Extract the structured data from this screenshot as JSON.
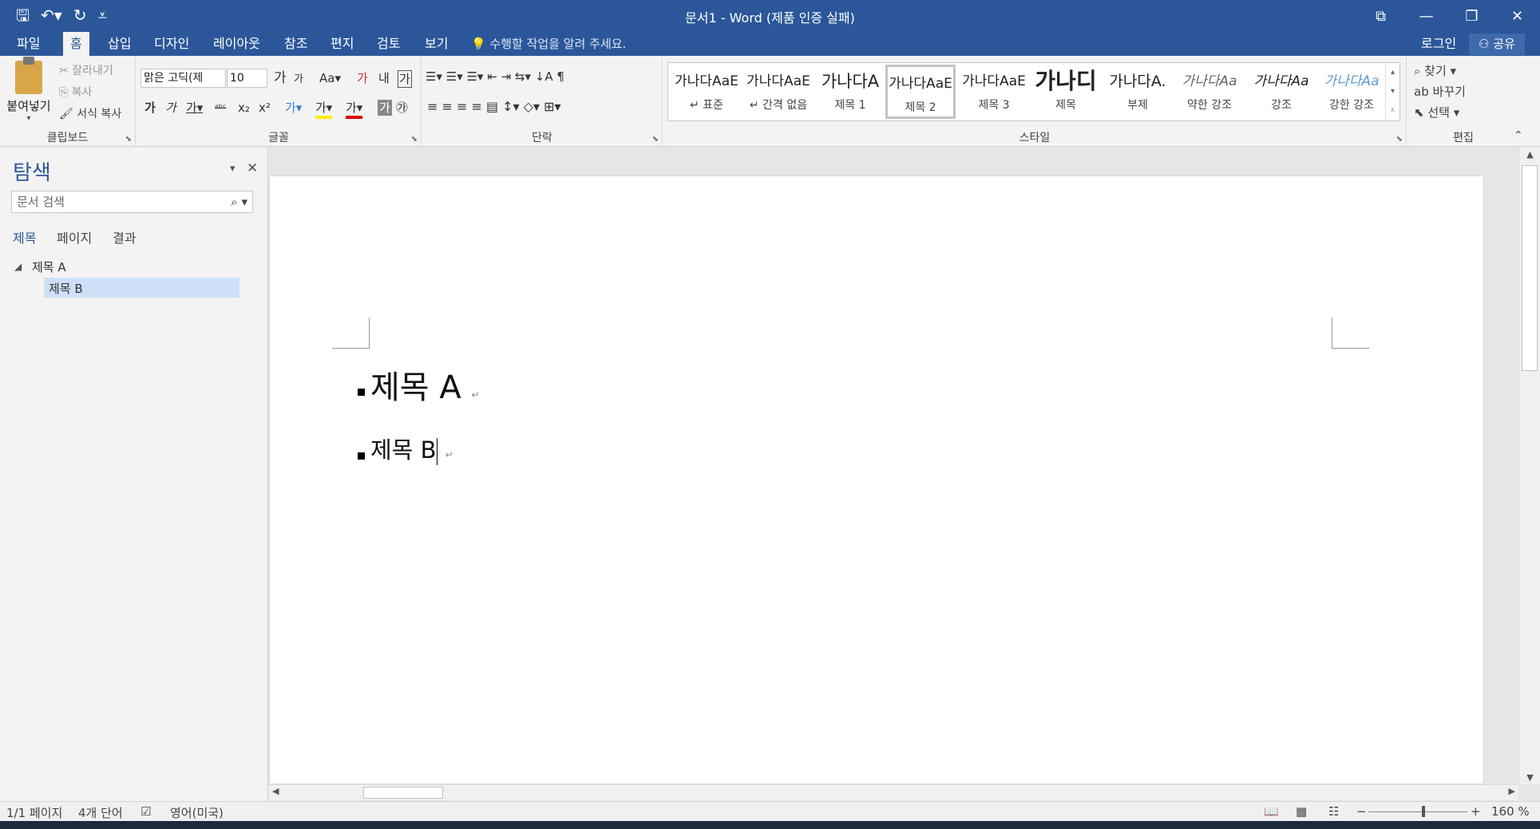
{
  "titlebar": {
    "title": "문서1 - Word (제품 인증 실패)",
    "qat_icons": [
      "save-icon",
      "undo-icon",
      "redo-icon",
      "customize-qat-icon"
    ],
    "qat_glyphs": [
      "🖫",
      "↶▾",
      "↻",
      "⩡"
    ],
    "window_glyphs": [
      "⧉",
      "—",
      "❐",
      "✕"
    ]
  },
  "tabs": [
    "파일",
    "홈",
    "삽입",
    "디자인",
    "레이아웃",
    "참조",
    "편지",
    "검토",
    "보기"
  ],
  "active_tab": "홈",
  "tellme": "💡 수행할 작업을 알려 주세요.",
  "login": "로그인",
  "share": "⚇ 공유",
  "ribbon": {
    "clipboard": {
      "label": "클립보드",
      "paste": "붙여넣기",
      "paste_arrow": "▾",
      "cut": "✂ 잘라내기",
      "copy": "⎘ 복사",
      "format_painter": "🖌 서식 복사"
    },
    "font": {
      "label": "글꼴",
      "font_name": "맑은 고딕(제",
      "font_size": "10",
      "grow": "가",
      "shrink": "가",
      "case": "Aa▾",
      "clear": "가",
      "phonetic": "내",
      "border": "가",
      "bold": "가",
      "italic": "가",
      "underline": "가▾",
      "strike": "ᵃᵇᶜ",
      "subscript": "x₂",
      "superscript": "x²",
      "effects": "가▾",
      "highlight": "가▾",
      "color": "가▾",
      "shading": "가",
      "enclose": "㉮"
    },
    "paragraph": {
      "label": "단락",
      "row1": "☰▾  ☰▾  ☰▾   ⇤  ⇥   ⇆▾   ↓A   ¶",
      "row2": "≡  ≡  ≡  ≡  ▤   ↕▾   ◇▾  ⊞▾"
    },
    "styles": {
      "label": "스타일",
      "items": [
        {
          "sample": "가나다AaE",
          "name": "↵ 표준"
        },
        {
          "sample": "가나다AaE",
          "name": "↵ 간격 없음"
        },
        {
          "sample": "가나다A",
          "name": "제목 1"
        },
        {
          "sample": "가나다AaE",
          "name": "제목 2"
        },
        {
          "sample": "가나다AaE",
          "name": "제목 3"
        },
        {
          "sample": "가나디",
          "name": "제목"
        },
        {
          "sample": "가나다A.",
          "name": "부제"
        },
        {
          "sample": "가나다Aa",
          "name": "약한 강조"
        },
        {
          "sample": "가나다Aa",
          "name": "강조"
        },
        {
          "sample": "가나다Aa",
          "name": "강한 강조"
        }
      ],
      "selected_index": 3,
      "scroll_glyphs": [
        "▴",
        "▾",
        "⩡"
      ]
    },
    "editing": {
      "label": "편집",
      "find": "⌕ 찾기 ▾",
      "replace": "ab 바꾸기",
      "select": "⬉ 선택 ▾"
    },
    "collapse_glyph": "⌃",
    "launcher_glyph": "⬊"
  },
  "nav": {
    "title": "탐색",
    "menu_glyph": "▾",
    "close_glyph": "✕",
    "search_placeholder": "문서 검색",
    "search_glyphs": "⌕ ▾",
    "tabs": [
      "제목",
      "페이지",
      "결과"
    ],
    "active_tab": "제목",
    "tree_toggle": "◢",
    "tree": [
      "제목 A",
      "제목 B"
    ],
    "selected": "제목 B"
  },
  "document": {
    "heading_a": "제목  A",
    "heading_b": "제목  B",
    "para_mark": "↵"
  },
  "scroll_glyphs": {
    "up": "▲",
    "down": "▼",
    "left": "◀",
    "right": "▶"
  },
  "statusbar": {
    "page": "1/1 페이지",
    "words": "4개 단어",
    "proof_glyph": "☑",
    "language": "영어(미국)",
    "view_glyphs": [
      "📖",
      "▦",
      "☷"
    ],
    "zoom_minus": "−",
    "zoom_plus": "+",
    "zoom": "160 %",
    "zoom_value": 1.6
  }
}
